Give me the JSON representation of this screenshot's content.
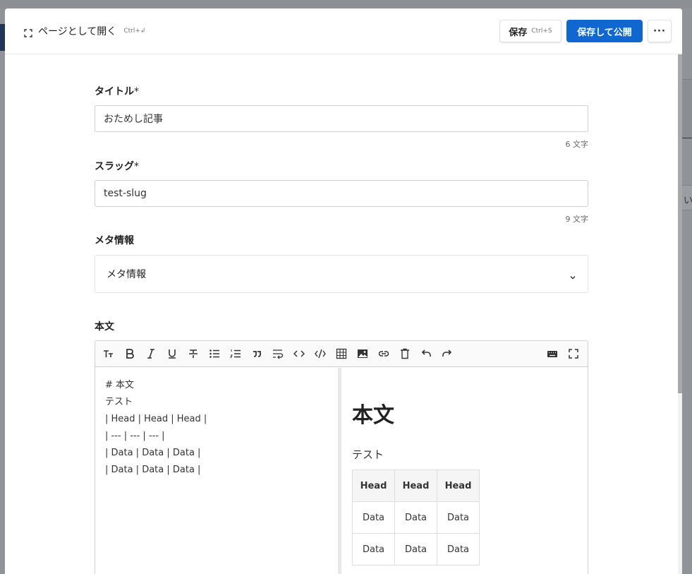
{
  "background": {
    "right_text": "い"
  },
  "header": {
    "open_page_label": "ページとして開く",
    "open_page_shortcut": "Ctrl+↲",
    "save_label": "保存",
    "save_shortcut": "Ctrl+S",
    "publish_label": "保存して公開",
    "more_label": "···"
  },
  "form": {
    "title": {
      "label": "タイトル",
      "required_mark": "*",
      "value": "おためし記事",
      "count": "6 文字"
    },
    "slug": {
      "label": "スラッグ",
      "required_mark": "*",
      "value": "test-slug",
      "count": "9 文字"
    },
    "meta": {
      "label": "メタ情報",
      "accordion_label": "メタ情報"
    },
    "body": {
      "label": "本文"
    }
  },
  "editor": {
    "toolbar": [
      "heading-icon",
      "bold-icon",
      "italic-icon",
      "underline-icon",
      "strikethrough-icon",
      "bullet-list-icon",
      "numbered-list-icon",
      "quote-icon",
      "wrap-icon",
      "code-icon",
      "code-block-icon",
      "table-icon",
      "image-icon",
      "link-icon",
      "delete-icon",
      "undo-icon",
      "redo-icon",
      "keyboard-icon",
      "fullscreen-icon"
    ],
    "source_lines": [
      "# 本文",
      "テスト",
      "| Head | Head | Head |",
      "| --- | --- | --- |",
      "| Data | Data | Data |",
      "| Data | Data | Data |"
    ],
    "preview": {
      "heading": "本文",
      "paragraph": "テスト",
      "table_headers": [
        "Head",
        "Head",
        "Head"
      ],
      "table_rows": [
        [
          "Data",
          "Data",
          "Data"
        ],
        [
          "Data",
          "Data",
          "Data"
        ]
      ]
    }
  },
  "colors": {
    "primary": "#1167d1",
    "overlay": "#909397"
  }
}
